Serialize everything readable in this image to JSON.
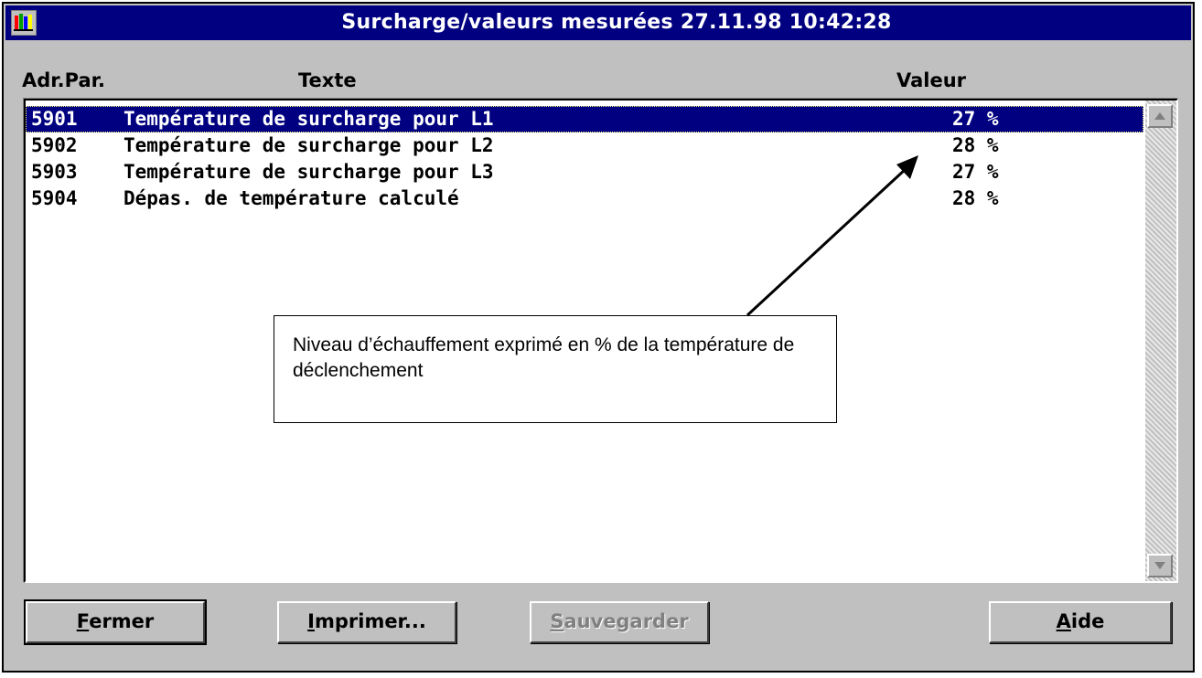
{
  "window": {
    "title": "Surcharge/valeurs mesurées 27.11.98 10:42:28"
  },
  "columns": {
    "address": "Adr.Par.",
    "text": "Texte",
    "value": "Valeur"
  },
  "rows": [
    {
      "address": "5901",
      "text": "Température de surcharge pour L1",
      "value": "27 %",
      "selected": true
    },
    {
      "address": "5902",
      "text": "Température de surcharge pour L2",
      "value": "28 %",
      "selected": false
    },
    {
      "address": "5903",
      "text": "Température de surcharge pour L3",
      "value": "27 %",
      "selected": false
    },
    {
      "address": "5904",
      "text": "Dépas. de température calculé",
      "value": "28 %",
      "selected": false
    }
  ],
  "buttons": {
    "close": {
      "mnemonic": "F",
      "rest": "ermer"
    },
    "print": {
      "mnemonic": "I",
      "rest": "mprimer..."
    },
    "save": {
      "mnemonic": "S",
      "rest": "auvegarder",
      "disabled": true
    },
    "help": {
      "mnemonic": "A",
      "rest": "ide"
    }
  },
  "annotation": {
    "text": "Niveau d’échauffement exprimé en % de la température de déclenchement"
  },
  "colors": {
    "titlebar": "#000080",
    "selection": "#000080",
    "window_bg": "#c0c0c0"
  },
  "icons": {
    "system_menu": "app-window-icon",
    "scroll_up": "triangle-up-icon",
    "scroll_down": "triangle-down-icon"
  }
}
